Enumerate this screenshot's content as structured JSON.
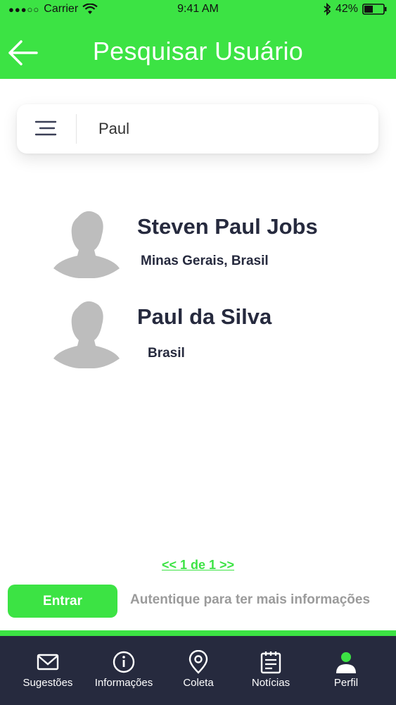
{
  "status_bar": {
    "signal": "●●●○○",
    "carrier": "Carrier",
    "time": "9:41 AM",
    "battery": "42%",
    "icons": [
      "wifi-icon",
      "bluetooth-icon",
      "battery-icon"
    ]
  },
  "header": {
    "title": "Pesquisar Usuário",
    "back_icon": "arrow-left-icon"
  },
  "search": {
    "value": "Paul",
    "placeholder": "",
    "filter_icon": "filter-lines-icon"
  },
  "results": [
    {
      "name": "Steven Paul Jobs",
      "location": "Minas Gerais, Brasil",
      "avatar_icon": "user-silhouette-icon"
    },
    {
      "name": "Paul da Silva",
      "location": "Brasil",
      "avatar_icon": "user-silhouette-icon"
    }
  ],
  "pagination": {
    "label": "<< 1 de 1 >>"
  },
  "login": {
    "button_label": "Entrar",
    "hint": "Autentique para ter mais informações"
  },
  "bottom_nav": [
    {
      "label": "Sugestões",
      "icon": "envelope-icon"
    },
    {
      "label": "Informações",
      "icon": "info-icon"
    },
    {
      "label": "Coleta",
      "icon": "map-pin-icon"
    },
    {
      "label": "Notícias",
      "icon": "newspaper-icon"
    },
    {
      "label": "Perfil",
      "icon": "user-icon",
      "active": true
    }
  ],
  "colors": {
    "accent": "#3ce344",
    "nav_background": "#262a3e",
    "text_dark": "#262a3e",
    "text_muted": "#9b9b9b",
    "avatar": "#bdbdbd"
  }
}
